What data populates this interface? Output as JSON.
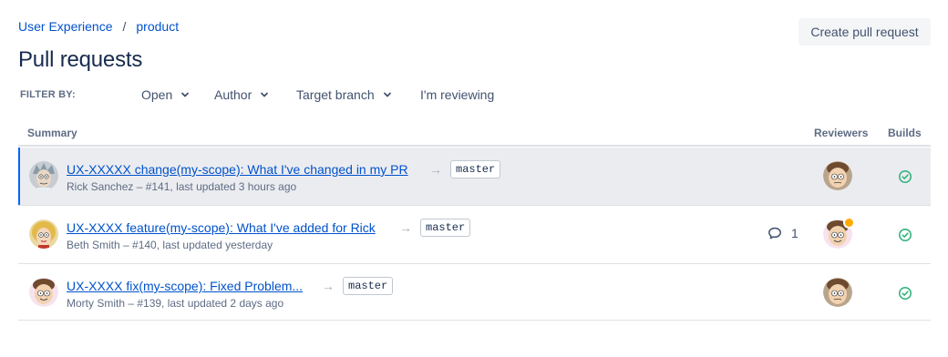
{
  "breadcrumb": {
    "project": "User Experience",
    "separator": "/",
    "repo": "product"
  },
  "page": {
    "title": "Pull requests"
  },
  "actions": {
    "create_label": "Create pull request"
  },
  "filters": {
    "label": "FILTER BY:",
    "state": "Open",
    "author": "Author",
    "target_branch": "Target branch",
    "reviewing": "I'm reviewing"
  },
  "columns": {
    "summary": "Summary",
    "reviewers": "Reviewers",
    "builds": "Builds"
  },
  "arrow_glyph": "→",
  "pull_requests": [
    {
      "title": "UX-XXXXX change(my-scope): What I've changed in my PR",
      "branch": "master",
      "meta": "Rick Sanchez – #141, last updated 3 hours ago",
      "author_avatar": "rick-avatar",
      "reviewer_avatar": "morty-avatar",
      "build_status": "success",
      "selected": true
    },
    {
      "title": "UX-XXXX feature(my-scope): What I've added for Rick",
      "branch": "master",
      "meta": "Beth Smith – #140, last updated yesterday",
      "author_avatar": "beth-avatar",
      "reviewer_avatar": "morty-avatar",
      "comments": "1",
      "reviewer_badge": "needs-work",
      "build_status": "success",
      "selected": false
    },
    {
      "title": "UX-XXXX fix(my-scope): Fixed Problem...",
      "branch": "master",
      "meta": "Morty Smith – #139, last updated 2 days ago",
      "author_avatar": "morty-avatar",
      "reviewer_avatar": "morty-avatar",
      "build_status": "success",
      "selected": false
    }
  ],
  "colors": {
    "link": "#0052cc",
    "selected_bg": "#ebecf0",
    "selected_bar": "#0065ff",
    "success": "#36b37e",
    "badge": "#ffab00"
  }
}
